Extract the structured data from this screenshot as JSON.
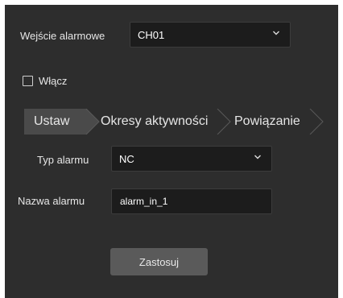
{
  "alarm_input": {
    "label": "Wejście alarmowe",
    "value": "CH01"
  },
  "enable": {
    "label": "Włącz",
    "checked": false
  },
  "steps": {
    "items": [
      {
        "label": "Ustaw",
        "active": true
      },
      {
        "label": "Okresy aktywności",
        "active": false
      },
      {
        "label": "Powiązanie",
        "active": false
      }
    ]
  },
  "alarm_type": {
    "label": "Typ alarmu",
    "value": "NC"
  },
  "alarm_name": {
    "label": "Nazwa alarmu",
    "value": "alarm_in_1"
  },
  "apply_button": {
    "label": "Zastosuj"
  },
  "colors": {
    "panel": "#2d2d2d",
    "field": "#1c1c1c",
    "active_step": "#4a4a4a",
    "button": "#5a5a5a"
  },
  "icons": {
    "dropdown": "chevron-down-icon",
    "checkbox": "checkbox-icon"
  }
}
